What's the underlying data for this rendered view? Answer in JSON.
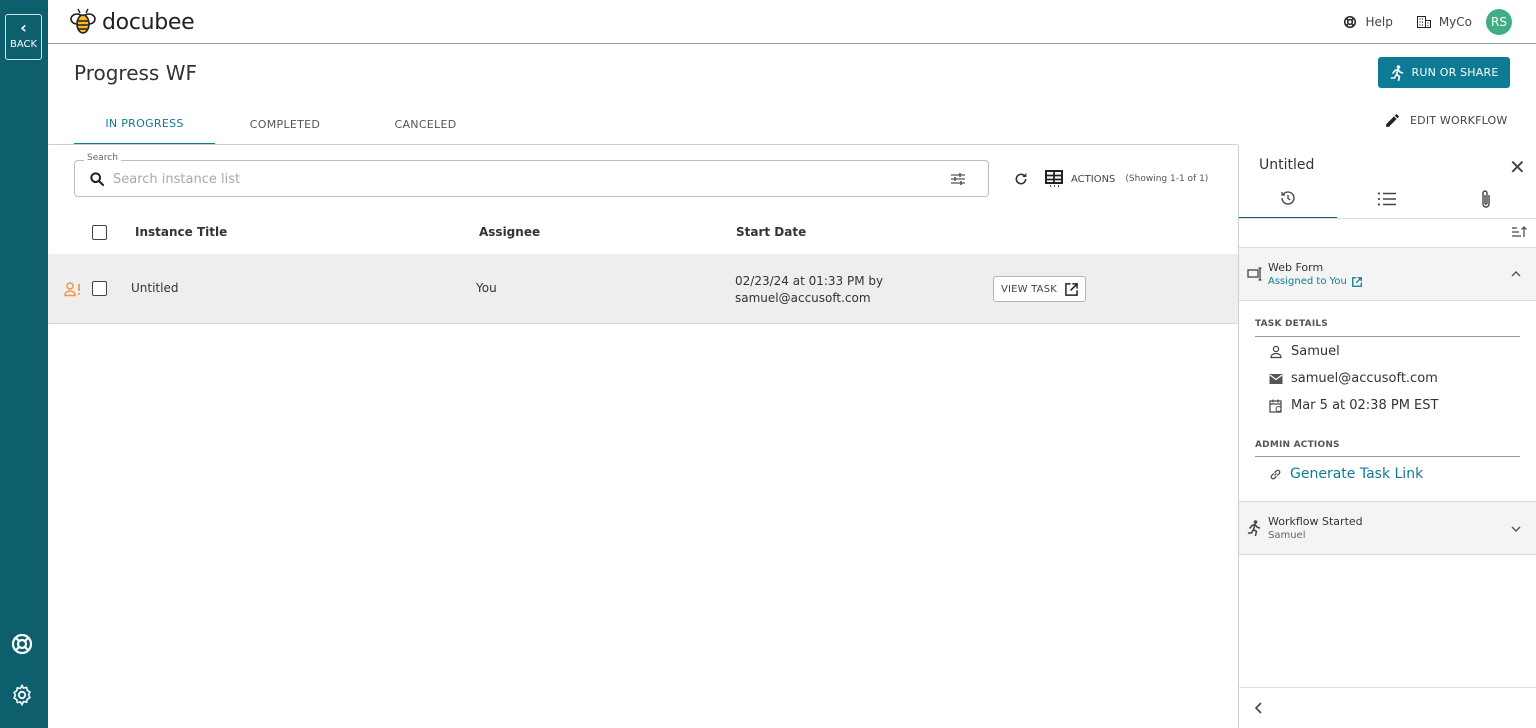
{
  "rail": {
    "back_label": "BACK"
  },
  "header": {
    "brand": "docubee",
    "help_label": "Help",
    "org_label": "MyCo",
    "avatar_initials": "RS"
  },
  "page": {
    "title": "Progress WF",
    "run_button": "RUN OR SHARE",
    "edit_workflow": "EDIT WORKFLOW",
    "tabs": [
      {
        "label": "IN PROGRESS",
        "active": true
      },
      {
        "label": "COMPLETED",
        "active": false
      },
      {
        "label": "CANCELED",
        "active": false
      }
    ]
  },
  "search": {
    "label": "Search",
    "placeholder": "Search instance list"
  },
  "toolbar": {
    "actions_label": "ACTIONS",
    "showing": "(Showing 1-1 of 1)"
  },
  "table": {
    "headers": [
      "Instance Title",
      "Assignee",
      "Start Date"
    ],
    "rows": [
      {
        "title": "Untitled",
        "assignee": "You",
        "start_date_line1": "02/23/24 at 01:33 PM by",
        "start_date_line2": "samuel@accusoft.com",
        "action": "VIEW TASK"
      }
    ]
  },
  "panel": {
    "title": "Untitled",
    "tabs": [
      "history-icon",
      "list-icon",
      "attachment-icon"
    ],
    "steps": [
      {
        "title": "Web Form",
        "subtitle": "Assigned to You",
        "expanded": true
      },
      {
        "title": "Workflow Started",
        "subtitle": "Samuel",
        "expanded": false
      }
    ],
    "task_details_label": "TASK DETAILS",
    "details": {
      "name": "Samuel",
      "email": "samuel@accusoft.com",
      "due": "Mar 5 at 02:38 PM EST"
    },
    "admin_actions_label": "ADMIN ACTIONS",
    "generate_link": "Generate Task Link"
  },
  "colors": {
    "rail": "#0e5f6e",
    "accent": "#0e7b95",
    "avatar": "#3fae84",
    "warning_icon": "#f0954a"
  }
}
